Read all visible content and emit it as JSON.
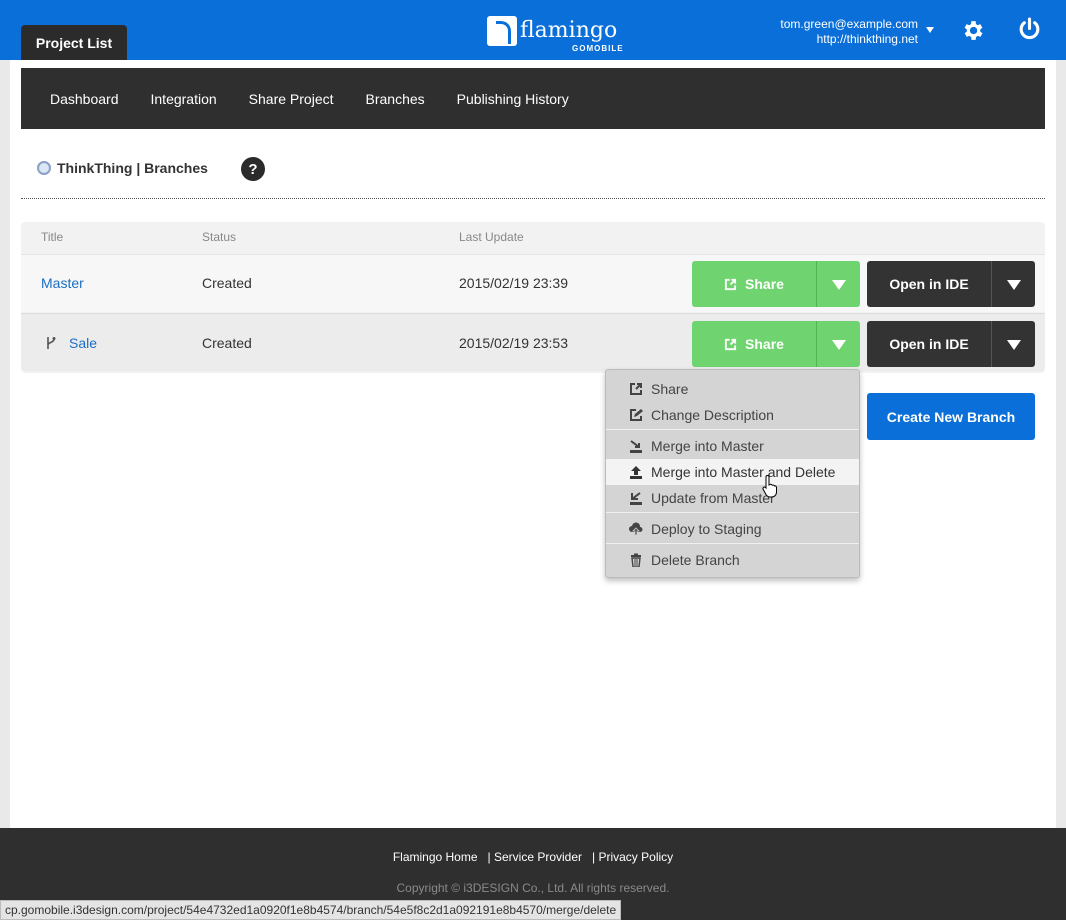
{
  "header": {
    "tab_label": "Project List",
    "logo_word": "flamingo",
    "logo_sub": "GOMOBILE",
    "user_email": "tom.green@example.com",
    "user_url": "http://thinkthing.net"
  },
  "nav": {
    "items": [
      "Dashboard",
      "Integration",
      "Share Project",
      "Branches",
      "Publishing History"
    ]
  },
  "breadcrumb": {
    "text": "ThinkThing | Branches",
    "help": "?"
  },
  "table": {
    "headers": [
      "Title",
      "Status",
      "Last Update"
    ],
    "rows": [
      {
        "title": "Master",
        "status": "Created",
        "updated": "2015/02/19 23:39"
      },
      {
        "title": "Sale",
        "status": "Created",
        "updated": "2015/02/19 23:53"
      }
    ],
    "share_label": "Share",
    "ide_label": "Open in IDE"
  },
  "create_button": "Create New Branch",
  "menu": {
    "items": [
      {
        "label": "Share",
        "icon": "share-icon"
      },
      {
        "label": "Change Description",
        "icon": "edit-icon"
      },
      {
        "label": "Merge into Master",
        "icon": "merge-icon"
      },
      {
        "label": "Merge into Master and Delete",
        "icon": "upload-icon"
      },
      {
        "label": "Update from Master",
        "icon": "update-icon"
      },
      {
        "label": "Deploy to Staging",
        "icon": "cloud-upload-icon"
      },
      {
        "label": "Delete Branch",
        "icon": "trash-icon"
      }
    ]
  },
  "footer": {
    "links": [
      "Flamingo Home",
      "| Service Provider",
      "| Privacy Policy"
    ],
    "copyright": "Copyright © i3DESIGN Co., Ltd. All rights reserved."
  },
  "status_bar": "cp.gomobile.i3design.com/project/54e4732ed1a0920f1e8b4574/branch/54e5f8c2d1a092191e8b4570/merge/delete",
  "colors": {
    "brand_blue": "#0a6fd8",
    "share_green": "#6fd46f",
    "dark": "#2f2f2f"
  }
}
